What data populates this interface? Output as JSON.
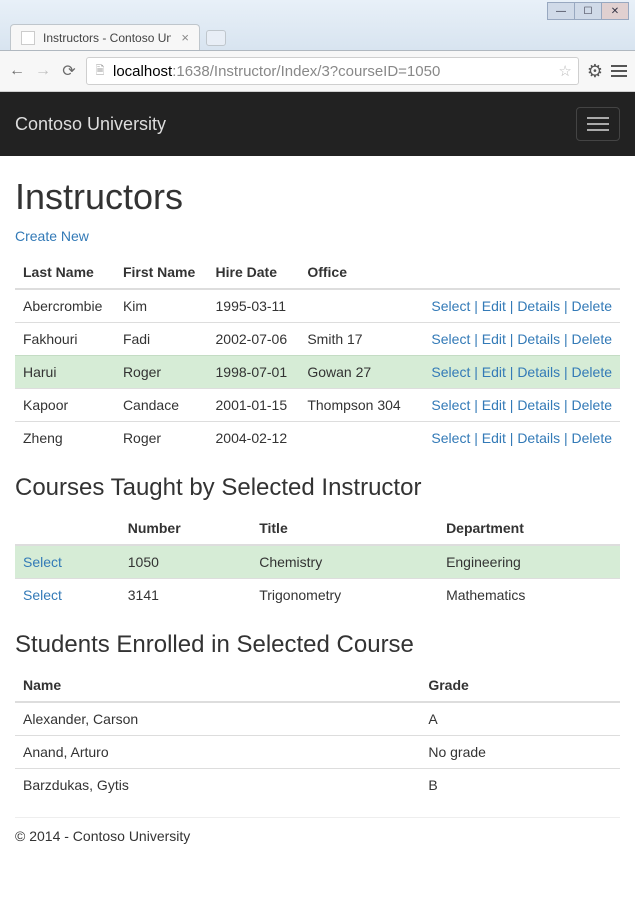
{
  "browser": {
    "tab_title": "Instructors - Contoso Univ",
    "url_host": "localhost",
    "url_rest": ":1638/Instructor/Index/3?courseID=1050"
  },
  "navbar": {
    "brand": "Contoso University"
  },
  "page": {
    "heading": "Instructors",
    "create_link": "Create New"
  },
  "instructors": {
    "headers": {
      "last": "Last Name",
      "first": "First Name",
      "hire": "Hire Date",
      "office": "Office"
    },
    "rows": [
      {
        "last": "Abercrombie",
        "first": "Kim",
        "hire": "1995-03-11",
        "office": ""
      },
      {
        "last": "Fakhouri",
        "first": "Fadi",
        "hire": "2002-07-06",
        "office": "Smith 17"
      },
      {
        "last": "Harui",
        "first": "Roger",
        "hire": "1998-07-01",
        "office": "Gowan 27"
      },
      {
        "last": "Kapoor",
        "first": "Candace",
        "hire": "2001-01-15",
        "office": "Thompson 304"
      },
      {
        "last": "Zheng",
        "first": "Roger",
        "hire": "2004-02-12",
        "office": ""
      }
    ],
    "selected_index": 2,
    "actions": {
      "select": "Select",
      "edit": "Edit",
      "details": "Details",
      "delete": "Delete"
    }
  },
  "courses": {
    "heading": "Courses Taught by Selected Instructor",
    "headers": {
      "number": "Number",
      "title": "Title",
      "dept": "Department"
    },
    "select_label": "Select",
    "rows": [
      {
        "number": "1050",
        "title": "Chemistry",
        "dept": "Engineering"
      },
      {
        "number": "3141",
        "title": "Trigonometry",
        "dept": "Mathematics"
      }
    ],
    "selected_index": 0
  },
  "students": {
    "heading": "Students Enrolled in Selected Course",
    "headers": {
      "name": "Name",
      "grade": "Grade"
    },
    "rows": [
      {
        "name": "Alexander, Carson",
        "grade": "A"
      },
      {
        "name": "Anand, Arturo",
        "grade": "No grade"
      },
      {
        "name": "Barzdukas, Gytis",
        "grade": "B"
      }
    ]
  },
  "footer": "© 2014 - Contoso University"
}
